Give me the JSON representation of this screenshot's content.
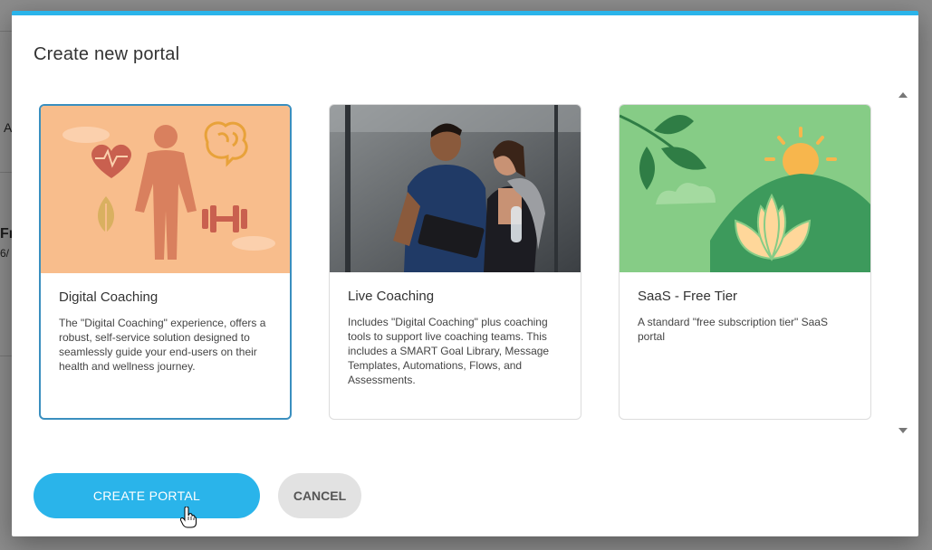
{
  "background": {
    "fragment_a": "A",
    "fragment_fr": "Fr",
    "fragment_6": "6/"
  },
  "dialog": {
    "title": "Create new portal",
    "accent_color": "#2ab4ea"
  },
  "cards": [
    {
      "title": "Digital Coaching",
      "description": "The \"Digital Coaching\" experience, offers a robust, self-service solution designed to seamlessly guide your end-users on their health and wellness journey.",
      "selected": true,
      "image": "health-wellness-illustration"
    },
    {
      "title": "Live Coaching",
      "description": "Includes \"Digital Coaching\" plus coaching tools to support live coaching teams. This includes a SMART Goal Library, Message Templates, Automations, Flows, and Assessments.",
      "selected": false,
      "image": "coach-with-client-photo"
    },
    {
      "title": "SaaS - Free Tier",
      "description": "A standard \"free subscription tier\" SaaS portal",
      "selected": false,
      "image": "lotus-sunrise-illustration"
    }
  ],
  "actions": {
    "create_label": "CREATE PORTAL",
    "cancel_label": "CANCEL"
  }
}
